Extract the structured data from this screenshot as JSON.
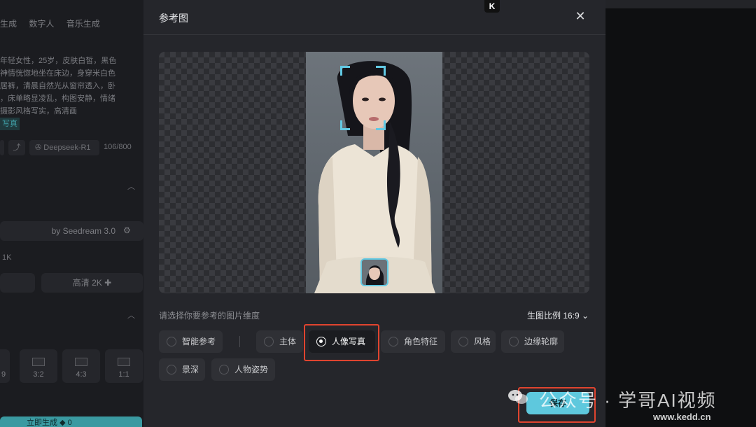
{
  "background": {
    "nav_tabs": [
      "生成",
      "数字人",
      "音乐生成"
    ],
    "prompt_lines": [
      "年轻女性，25岁，皮肤白皙，黑色",
      "神情恍惚地坐在床边，身穿米白色",
      "居裤，清晨自然光从窗帘透入，卧",
      "，床单略显凌乱，构图安静，情绪",
      "摄影风格写实，高清画"
    ],
    "prompt_tag": "写真",
    "model_chip": "Deepseek-R1",
    "char_count": "106/800",
    "model_name": "by Seedream 3.0",
    "resolution_1k": "1K",
    "resolution_2k": "高清 2K",
    "ratios": [
      "9",
      "3:2",
      "4:3",
      "1:1"
    ],
    "generate_label": "立即生成",
    "generate_count": "0"
  },
  "modal": {
    "title": "参考图",
    "close_icon": "close-icon",
    "dimension_label": "请选择你要参考的图片维度",
    "ratio_label": "生图比例 16:9",
    "options": [
      {
        "label": "智能参考",
        "selected": false
      },
      {
        "label": "主体",
        "selected": false
      },
      {
        "label": "人像写真",
        "selected": true
      },
      {
        "label": "角色特征",
        "selected": false
      },
      {
        "label": "风格",
        "selected": false
      },
      {
        "label": "边缘轮廓",
        "selected": false
      },
      {
        "label": "景深",
        "selected": false
      },
      {
        "label": "人物姿势",
        "selected": false
      }
    ],
    "save_label": "保存"
  },
  "watermark": {
    "text": "公众号 · 学哥AI视频",
    "url": "www.kedd.cn"
  },
  "colors": {
    "accent": "#5ec8dd",
    "highlight": "#e0442f",
    "modal_bg": "#25262b"
  }
}
